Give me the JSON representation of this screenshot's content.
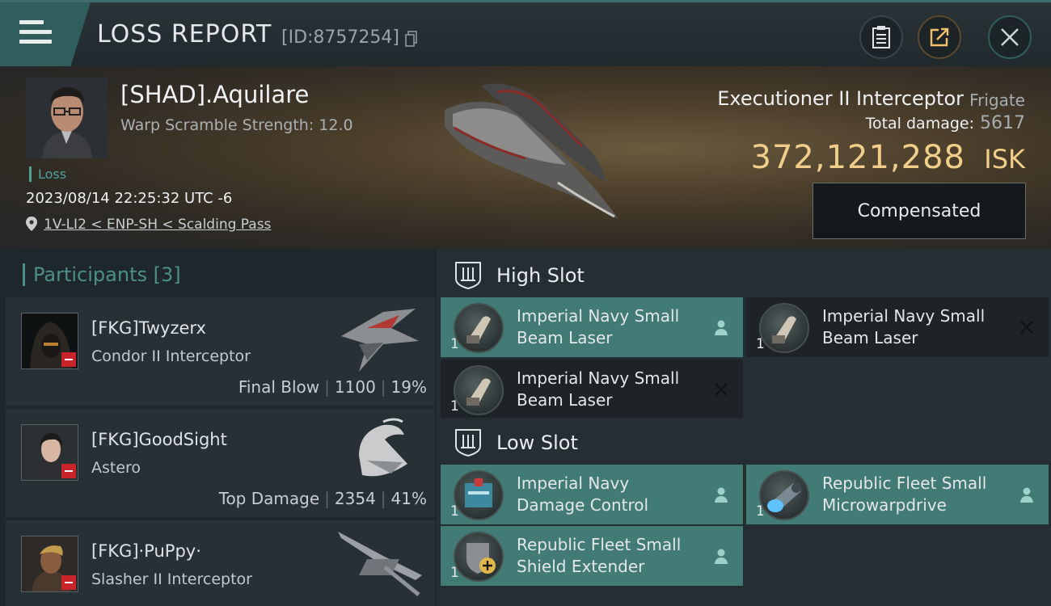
{
  "header": {
    "title": "LOSS REPORT",
    "report_id": "[ID:8757254]"
  },
  "victim": {
    "name": "[SHAD].Aquilare",
    "warp_scramble": "Warp Scramble Strength: 12.0",
    "tag": "Loss",
    "timestamp": "2023/08/14 22:25:32 UTC -6",
    "location": "1V-LI2 < ENP-SH < Scalding Pass",
    "ship_name": "Executioner II Interceptor",
    "ship_class": "Frigate",
    "total_damage_label": "Total damage:",
    "total_damage": "5617",
    "isk_value": "372,121,288",
    "isk_unit": "ISK",
    "compensation_label": "Compensated"
  },
  "participants": {
    "label": "Participants",
    "count": "[3]",
    "items": [
      {
        "name": "[FKG]Twyzerx",
        "ship": "Condor II Interceptor",
        "role": "Final Blow",
        "damage": "1100",
        "percent": "19%"
      },
      {
        "name": "[FKG]GoodSight",
        "ship": "Astero",
        "role": "Top Damage",
        "damage": "2354",
        "percent": "41%"
      },
      {
        "name": "[FKG]·PuPpy·",
        "ship": "Slasher II Interceptor",
        "role": "",
        "damage": "",
        "percent": ""
      }
    ]
  },
  "fitting": {
    "high_slot_label": "High Slot",
    "low_slot_label": "Low Slot",
    "high": [
      {
        "line1": "Imperial Navy Small",
        "line2": "Beam Laser",
        "qty": "1",
        "status": "dropped"
      },
      {
        "line1": "Imperial Navy Small",
        "line2": "Beam Laser",
        "qty": "1",
        "status": "destroyed"
      },
      {
        "line1": "Imperial Navy Small",
        "line2": "Beam Laser",
        "qty": "1",
        "status": "destroyed"
      }
    ],
    "low": [
      {
        "line1": "Imperial Navy",
        "line2": "Damage Control",
        "qty": "1",
        "status": "dropped"
      },
      {
        "line1": "Republic Fleet Small",
        "line2": "Microwarpdrive",
        "qty": "1",
        "status": "dropped"
      },
      {
        "line1": "Republic Fleet Small",
        "line2": "Shield Extender",
        "qty": "1",
        "status": "dropped"
      }
    ]
  },
  "colors": {
    "accent": "#4fa39b",
    "isk": "#f1cf8a",
    "fitted_module": "#427a76",
    "kill_badge": "#c8242a"
  }
}
